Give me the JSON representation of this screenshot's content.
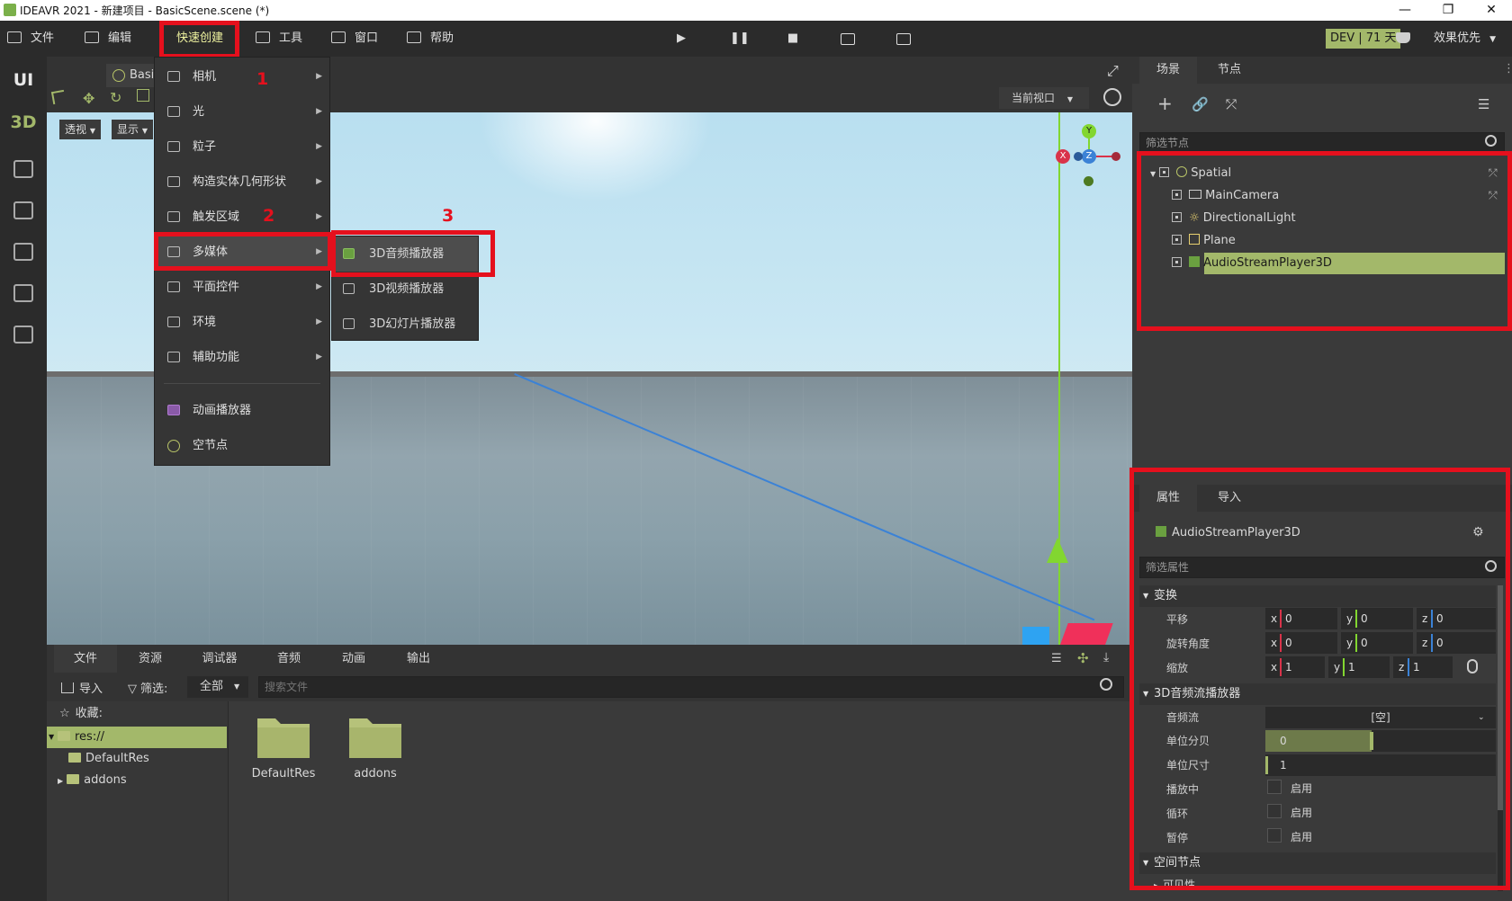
{
  "window": {
    "title": "IDEAVR 2021 - 新建项目 - BasicScene.scene (*)",
    "min_glyph": "—",
    "max_glyph": "❐",
    "close_glyph": "✕"
  },
  "menubar": {
    "file": "文件",
    "edit": "编辑",
    "quick_create": "快速创建",
    "tools": "工具",
    "window": "窗口",
    "help": "帮助",
    "dev_badge": "DEV | 71 天",
    "quality": "效果优先"
  },
  "left_toolbar": {
    "ui": "UI",
    "three_d": "3D"
  },
  "viewport": {
    "tab": "BasicScene(*",
    "perspective": "透视",
    "display": "显示",
    "current_view": "当前视口",
    "gizmo": {
      "x": "X",
      "y": "Y",
      "z": "Z"
    }
  },
  "quick_menu": {
    "items": [
      {
        "label": "相机",
        "icon": "camera-icon",
        "sub": true
      },
      {
        "label": "光",
        "icon": "light-bulb-icon",
        "sub": true
      },
      {
        "label": "粒子",
        "icon": "particles-icon",
        "sub": true
      },
      {
        "label": "构造实体几何形状",
        "icon": "csg-icon",
        "sub": true
      },
      {
        "label": "触发区域",
        "icon": "trigger-area-icon",
        "sub": true
      },
      {
        "label": "多媒体",
        "icon": "multimedia-icon",
        "sub": true
      },
      {
        "label": "平面控件",
        "icon": "plane-control-icon",
        "sub": true
      },
      {
        "label": "环境",
        "icon": "environment-icon",
        "sub": true
      },
      {
        "label": "辅助功能",
        "icon": "helper-icon",
        "sub": true
      },
      {
        "label": "动画播放器",
        "icon": "animation-player-icon",
        "sub": false
      },
      {
        "label": "空节点",
        "icon": "empty-node-icon",
        "sub": false
      }
    ]
  },
  "sub_menu": {
    "items": [
      {
        "label": "3D音频播放器"
      },
      {
        "label": "3D视频播放器"
      },
      {
        "label": "3D幻灯片播放器"
      }
    ]
  },
  "annotations": {
    "one": "1",
    "two": "2",
    "three": "3"
  },
  "file_panel": {
    "tabs": [
      "文件",
      "资源",
      "调试器",
      "音频",
      "动画",
      "输出"
    ],
    "import": "导入",
    "filter_label": "筛选:",
    "filter_value": "全部",
    "search_placeholder": "搜索文件",
    "favorites": "收藏:",
    "tree": [
      "res://",
      "DefaultRes",
      "addons"
    ],
    "grid": [
      "DefaultRes",
      "addons"
    ]
  },
  "scene_panel": {
    "tabs": [
      "场景",
      "节点"
    ],
    "filter_placeholder": "筛选节点",
    "nodes": [
      "Spatial",
      "MainCamera",
      "DirectionalLight",
      "Plane",
      "AudioStreamPlayer3D"
    ]
  },
  "prop_panel": {
    "tabs": [
      "属性",
      "导入"
    ],
    "node_name": "AudioStreamPlayer3D",
    "filter_placeholder": "筛选属性",
    "transform_section": "变换",
    "translation_label": "平移",
    "rotation_label": "旋转角度",
    "scale_label": "缩放",
    "translation": {
      "x": "0",
      "y": "0",
      "z": "0"
    },
    "rotation": {
      "x": "0",
      "y": "0",
      "z": "0"
    },
    "scale": {
      "x": "1",
      "y": "1",
      "z": "1"
    },
    "audio_section": "3D音频流播放器",
    "stream_label": "音频流",
    "stream_value": "[空]",
    "unit_db_label": "单位分贝",
    "unit_db": "0",
    "unit_size_label": "单位尺寸",
    "unit_size": "1",
    "playing_label": "播放中",
    "loop_label": "循环",
    "pause_label": "暂停",
    "enable": "启用",
    "spatial_section": "空间节点",
    "visibility": "可见性"
  },
  "colors": {
    "accent": "#a3b86a",
    "highlight_red": "#e5101d",
    "menu_bg": "#2b2b2b",
    "panel_bg": "#3a3a3a",
    "axis_x": "#d9334a",
    "axis_y": "#82d630",
    "axis_z": "#3b82d6"
  }
}
